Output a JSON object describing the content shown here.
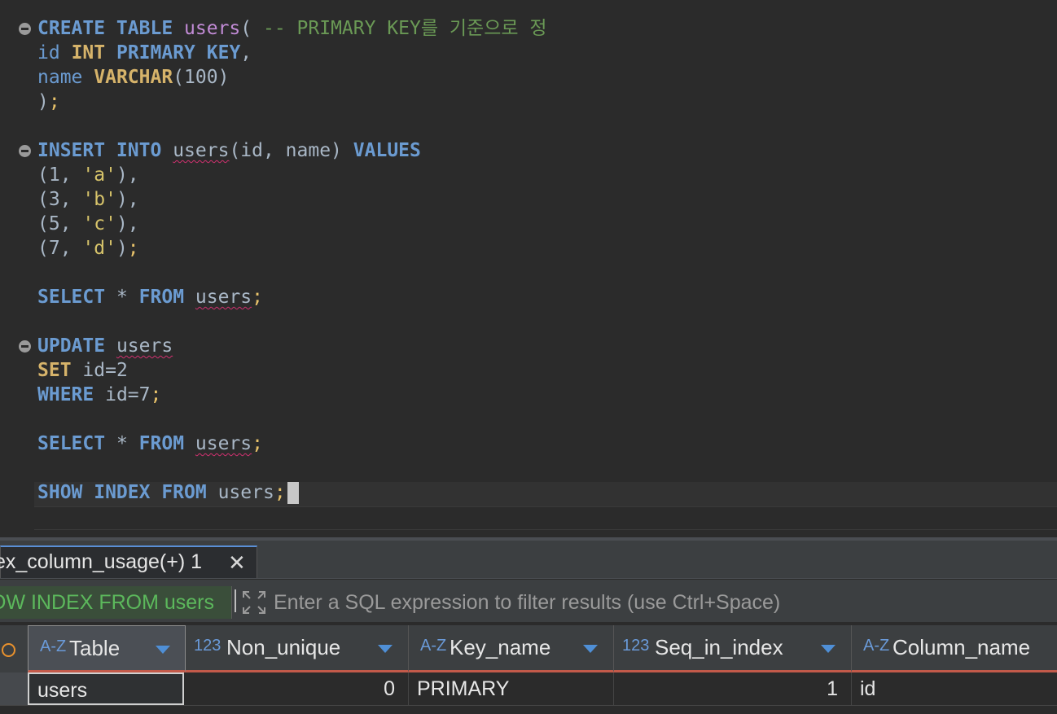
{
  "editor": {
    "create_kw": "CREATE TABLE",
    "create_table": "users",
    "create_paren": "(",
    "create_comment": "-- PRIMARY KEY를 기준으로 정",
    "col1_name": "id",
    "col1_type": "INT",
    "col1_constraint": "PRIMARY KEY",
    "col1_comma": ",",
    "col2_name": "name",
    "col2_type": "VARCHAR",
    "col2_size": "(100)",
    "close_paren": ")",
    "semicolon": ";",
    "insert_kw": "INSERT INTO",
    "insert_table": "users",
    "insert_cols": "(id, name)",
    "values_kw": "VALUES",
    "values": [
      {
        "open": "(1, ",
        "str": "'a'",
        "close": "),"
      },
      {
        "open": "(3, ",
        "str": "'b'",
        "close": "),"
      },
      {
        "open": "(5, ",
        "str": "'c'",
        "close": "),"
      },
      {
        "open": "(7, ",
        "str": "'d'",
        "close": ")"
      }
    ],
    "select_kw": "SELECT",
    "star": "*",
    "from_kw": "FROM",
    "table": "users",
    "update_kw": "UPDATE",
    "set_kw": "SET",
    "set_expr": "id=2",
    "where_kw": "WHERE",
    "where_expr": "id=7",
    "show_kw": "SHOW INDEX FROM",
    "show_table": "users"
  },
  "results": {
    "tab_label": "ex_column_usage(+) 1",
    "tab_close": "✕",
    "query_text": "OW INDEX FROM users",
    "filter_placeholder": "Enter a SQL expression to filter results (use Ctrl+Space)",
    "columns": [
      {
        "type": "A-Z",
        "name": "Table"
      },
      {
        "type": "123",
        "name": "Non_unique"
      },
      {
        "type": "A-Z",
        "name": "Key_name"
      },
      {
        "type": "123",
        "name": "Seq_in_index"
      },
      {
        "type": "A-Z",
        "name": "Column_name"
      }
    ],
    "row": [
      "users",
      "0",
      "PRIMARY",
      "1",
      "id"
    ]
  },
  "colors": {
    "keyword": "#6b9bd1",
    "type": "#d6b36a",
    "table_name": "#c28bd6",
    "comment": "#6a9955",
    "string": "#d6c36a",
    "error_underline": "#d1306f",
    "query_green": "#5cb85c",
    "header_accent": "#c35a4a"
  }
}
